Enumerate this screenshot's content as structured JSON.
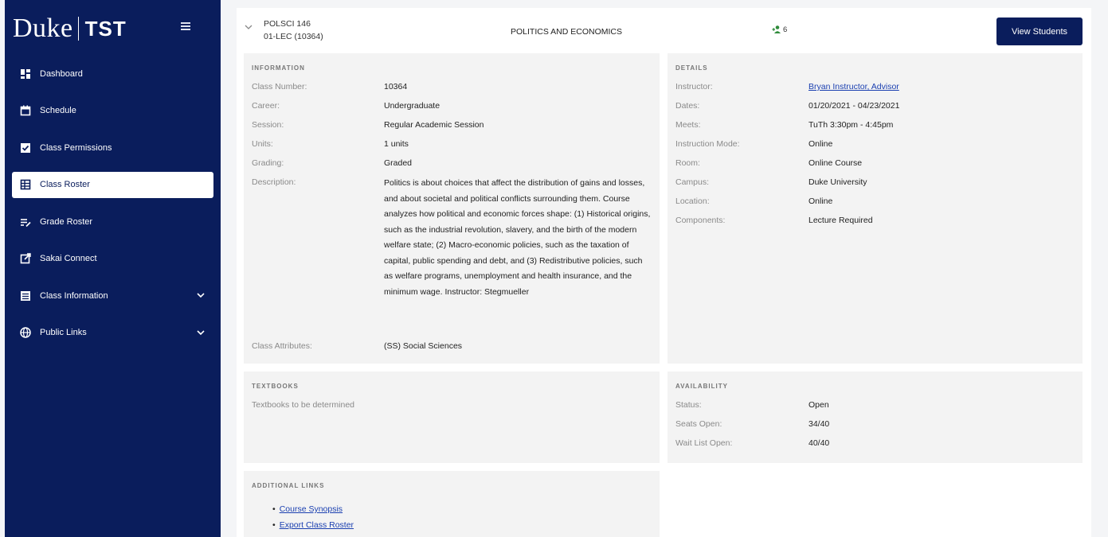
{
  "sidebar": {
    "brand_duke": "Duke",
    "brand_tst": "TST",
    "items": [
      {
        "label": "Dashboard"
      },
      {
        "label": "Schedule"
      },
      {
        "label": "Class Permissions"
      },
      {
        "label": "Class Roster"
      },
      {
        "label": "Grade Roster"
      },
      {
        "label": "Sakai Connect"
      },
      {
        "label": "Class Information"
      },
      {
        "label": "Public Links"
      }
    ]
  },
  "header": {
    "course_code": "POLSCI 146",
    "section": "01-LEC (10364)",
    "title": "POLITICS AND ECONOMICS",
    "enrolled": "6",
    "view_students": "View Students"
  },
  "information": {
    "title": "INFORMATION",
    "rows": [
      {
        "label": "Class Number:",
        "value": "10364"
      },
      {
        "label": "Career:",
        "value": "Undergraduate"
      },
      {
        "label": "Session:",
        "value": "Regular Academic Session"
      },
      {
        "label": "Units:",
        "value": "1 units"
      },
      {
        "label": "Grading:",
        "value": "Graded"
      },
      {
        "label": "Description:",
        "value": "Politics is about choices that affect the distribution of gains and losses, and about societal and political conflicts surrounding them. Course analyzes how political and economic forces shape: (1) Historical origins, such as the industrial revolution, slavery, and the birth of the modern welfare state; (2) Macro-economic policies, such as the taxation of capital, public spending and debt, and (3) Redistributive policies, such as welfare programs, unemployment and health insurance, and the minimum wage. Instructor: Stegmueller"
      },
      {
        "label": "Class Attributes:",
        "value": "(SS) Social Sciences"
      }
    ]
  },
  "details": {
    "title": "DETAILS",
    "rows": [
      {
        "label": "Instructor:",
        "value": "Bryan Instructor, Advisor"
      },
      {
        "label": "Dates:",
        "value": "01/20/2021 - 04/23/2021"
      },
      {
        "label": "Meets:",
        "value": "TuTh 3:30pm - 4:45pm"
      },
      {
        "label": "Instruction Mode:",
        "value": "Online"
      },
      {
        "label": "Room:",
        "value": "Online Course"
      },
      {
        "label": "Campus:",
        "value": "Duke University"
      },
      {
        "label": "Location:",
        "value": "Online"
      },
      {
        "label": "Components:",
        "value": "Lecture Required"
      }
    ]
  },
  "textbooks": {
    "title": "TEXTBOOKS",
    "text": "Textbooks to be determined"
  },
  "availability": {
    "title": "AVAILABILITY",
    "rows": [
      {
        "label": "Status:",
        "value": "Open"
      },
      {
        "label": "Seats Open:",
        "value": "34/40"
      },
      {
        "label": "Wait List Open:",
        "value": "40/40"
      }
    ]
  },
  "links": {
    "title": "ADDITIONAL LINKS",
    "items": [
      "Course Synopsis",
      "Export Class Roster"
    ]
  },
  "colors": {
    "sidebar": "#0a1d5c",
    "accent": "#0a1d5c",
    "enroll_icon": "#2e8b3a",
    "link": "#1a3fb0"
  }
}
